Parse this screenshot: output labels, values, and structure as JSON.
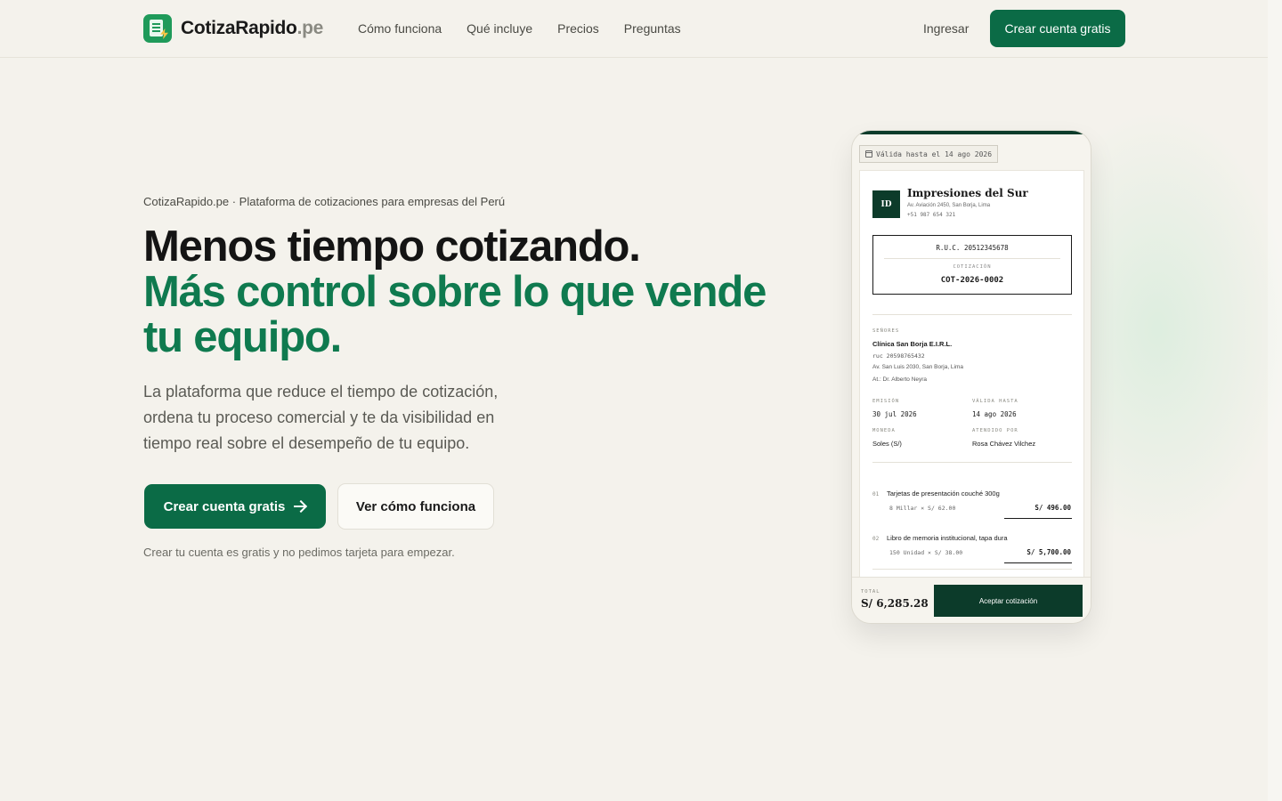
{
  "header": {
    "logo_name": "CotizaRapido",
    "logo_tld": ".pe",
    "nav": [
      "Cómo funciona",
      "Qué incluye",
      "Precios",
      "Preguntas"
    ],
    "login": "Ingresar",
    "cta": "Crear cuenta gratis"
  },
  "hero": {
    "eyebrow": "CotizaRapido.pe · Plataforma de cotizaciones para empresas del Perú",
    "headline_line1": "Menos tiempo cotizando.",
    "headline_line2": "Más control sobre lo que vende",
    "headline_line3": "tu equipo.",
    "lead": "La plataforma que reduce el tiempo de cotización, ordena tu proceso comercial y te da visibilidad en tiempo real sobre el desempeño de tu equipo.",
    "cta_primary": "Crear cuenta gratis",
    "cta_secondary": "Ver cómo funciona",
    "note": "Crear tu cuenta es gratis y no pedimos tarjeta para empezar."
  },
  "quote": {
    "validity": "Válida hasta el 14 ago 2026",
    "badge": "ID",
    "company": "Impresiones del Sur",
    "company_address": "Av. Aviación 2450, San Borja, Lima",
    "company_phone": "+51 987 654 321",
    "ruc": "R.U.C. 20512345678",
    "cotizacion_label": "COTIZACIÓN",
    "cotizacion_number": "COT-2026-0002",
    "client_label": "SEÑORES",
    "client_name": "Clínica San Borja E.I.R.L.",
    "client_ruc_label": "ruc",
    "client_ruc": "20598765432",
    "client_address": "Av. San Luis 2030, San Borja, Lima",
    "client_attention": "At.: Dr. Alberto Neyra",
    "emission_label": "EMISIÓN",
    "emission_date": "30 jul 2026",
    "valid_label": "VÁLIDA HASTA",
    "valid_date": "14 ago 2026",
    "currency_label": "MONEDA",
    "currency": "Soles (S/)",
    "attended_label": "ATENDIDO POR",
    "attended_by": "Rosa Chávez Vilchez",
    "items": [
      {
        "idx": "01",
        "desc": "Tarjetas de presentación couché 300g",
        "qty": "8 Millar × S/ 62.00",
        "amount": "S/ 496.00"
      },
      {
        "idx": "02",
        "desc": "Libro de memoria institucional, tapa dura",
        "qty": "150 Unidad × S/ 38.00",
        "amount": "S/ 5,700.00"
      }
    ],
    "total_label": "TOTAL",
    "total": "S/ 6,285.28",
    "accept": "Aceptar cotización"
  },
  "colors": {
    "brand": "#0b6b46",
    "headline_green": "#0f7a4f",
    "dark_green": "#0c3b2a",
    "background": "#f4f2ec"
  }
}
